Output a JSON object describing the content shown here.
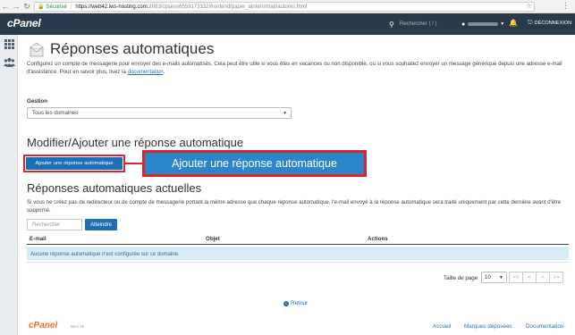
{
  "browser": {
    "secure_label": "Sécurisé",
    "url_host": "https://web42.lws-hosting.com",
    "url_path": ":2083/cpsess6559173332/frontend/paper_lantern/mail/autores.html"
  },
  "header": {
    "logo": "cPanel",
    "search_placeholder": "Rechercher ( / )",
    "logout_label": "DÉCONNEXION"
  },
  "page": {
    "title": "Réponses automatiques",
    "title_icon_text": "AUTO",
    "intro_text": "Configurez un compte de messagerie pour envoyer des e-mails automatisés. Cela peut être utile si vous êtes en vacances ou non disponible, ou si vous souhaitez envoyer un message générique depuis une adresse e-mail d'assistance. Pour en savoir plus, lisez la ",
    "intro_link": "documentation",
    "intro_end": "."
  },
  "gestion": {
    "label": "Gestion",
    "selected": "Tous les domaines"
  },
  "add_section": {
    "heading": "Modifier/Ajouter une réponse automatique",
    "button_label": "Ajouter une réponse automatique",
    "callout_label": "Ajouter une réponse automatique"
  },
  "current_section": {
    "heading": "Réponses automatiques actuelles",
    "description": "Si vous ne créez pas de redirecteur ou de compte de messagerie portant la même adresse que chaque réponse automatique, l'e-mail envoyé à la réponse automatique sera traité uniquement par cette dernière avant d'être supprimé.",
    "search_placeholder": "Rechercher",
    "search_button": "Atteindre"
  },
  "table": {
    "columns": [
      "E-mail",
      "Objet",
      "Actions"
    ],
    "empty_message": "Aucune réponse automatique n'est configurée sur ce domaine."
  },
  "pagination": {
    "page_size_label": "Taille de page",
    "page_size": "10",
    "buttons": [
      "<<",
      "<",
      ">",
      ">>"
    ]
  },
  "back_link": "Retour",
  "footer": {
    "logo": "cPanel",
    "version": "68.0.28",
    "links": [
      "Accueil",
      "Marques déposées",
      "Documentation"
    ]
  },
  "colors": {
    "header_bg": "#293a4a",
    "primary_button": "#1d6fb5",
    "callout_button": "#2a86c9",
    "highlight_red": "#d7262f",
    "footer_logo": "#ff6c2c",
    "info_bg": "#d9edf7"
  }
}
